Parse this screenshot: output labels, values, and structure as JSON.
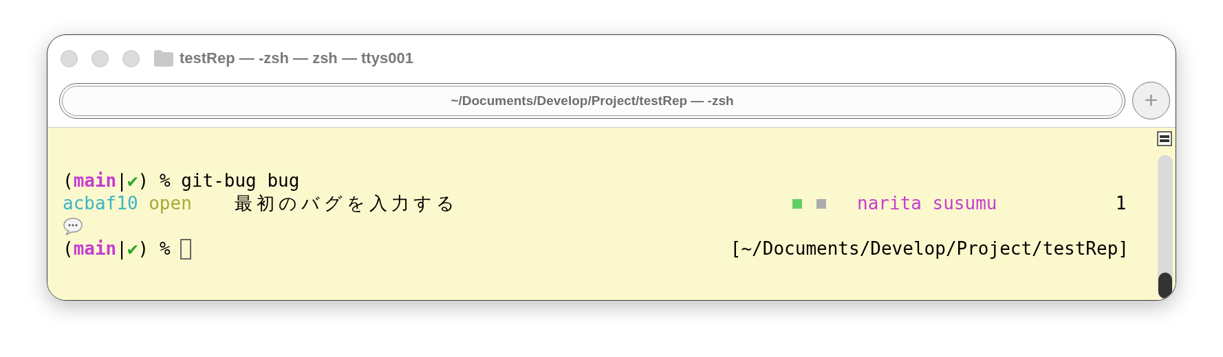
{
  "window": {
    "title": "testRep — -zsh — zsh — ttys001"
  },
  "tab": {
    "label": "~/Documents/Develop/Project/testRep — -zsh",
    "selected": true
  },
  "new_tab_button": {
    "label": "+"
  },
  "terminal": {
    "command_line": {
      "prompt": [
        {
          "text": "(",
          "color": "#000000"
        },
        {
          "text": "main",
          "color": "#c63ed0",
          "bold": true
        },
        {
          "text": "|",
          "color": "#000000"
        },
        {
          "text": "✔",
          "color": "#2ca82c"
        },
        {
          "text": ") %",
          "color": "#000000"
        }
      ],
      "command": "git-bug bug"
    },
    "bug_row": {
      "id": "acbaf10",
      "status": "open",
      "title": "最初のバグを入力する",
      "labels": [
        {
          "color": "#5fd066"
        },
        {
          "color": "#acacac"
        }
      ],
      "author": "narita susumu",
      "comments": "1"
    },
    "prompt_line": {
      "prompt": [
        {
          "text": "(",
          "color": "#000000"
        },
        {
          "text": "main",
          "color": "#c63ed0",
          "bold": true
        },
        {
          "text": "|",
          "color": "#000000"
        },
        {
          "text": "✔",
          "color": "#2ca82c"
        },
        {
          "text": ") %",
          "color": "#000000"
        }
      ],
      "right_prompt": "[~/Documents/Develop/Project/testRep]"
    }
  }
}
